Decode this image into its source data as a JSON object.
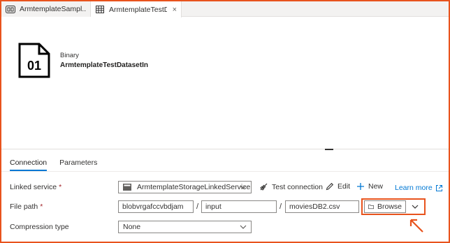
{
  "tabs": [
    {
      "label": "ArmtemplateSampl...",
      "icon": "pipeline-icon",
      "active": false
    },
    {
      "label": "ArmtemplateTestDa...",
      "icon": "table-icon",
      "active": true,
      "close": "×"
    }
  ],
  "dataset": {
    "icon_text": "01",
    "type": "Binary",
    "name": "ArmtemplateTestDatasetIn"
  },
  "subtabs": [
    "Connection",
    "Parameters"
  ],
  "linked_service": {
    "label": "Linked service",
    "required_mark": "*",
    "value": "ArmtemplateStorageLinkedService",
    "test_connection": "Test connection",
    "edit": "Edit",
    "new": "New",
    "learn_more": "Learn more"
  },
  "file_path": {
    "label": "File path",
    "required_mark": "*",
    "container": "blobvrgafccvbdjam",
    "directory": "input",
    "file": "moviesDB2.csv",
    "separator": "/",
    "browse": "Browse"
  },
  "compression": {
    "label": "Compression type",
    "value": "None"
  },
  "colors": {
    "highlight": "#e8531d",
    "accent": "#0078d4"
  }
}
